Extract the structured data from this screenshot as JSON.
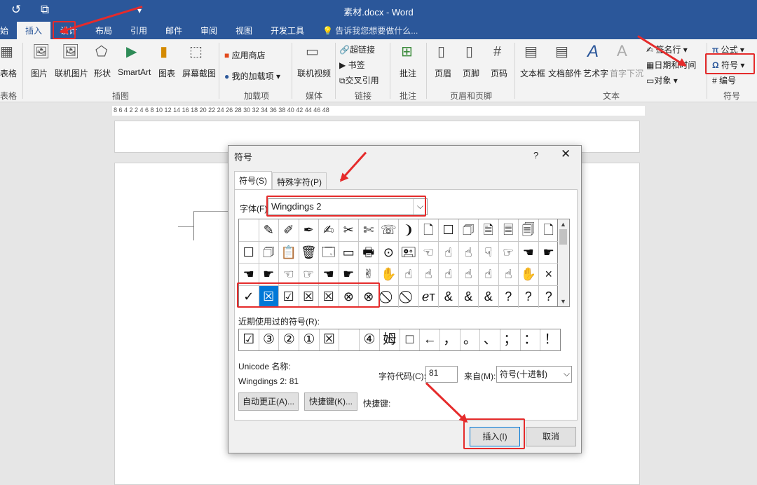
{
  "titlebar": {
    "title": "素材.docx - Word",
    "undo_icon": "↺",
    "cloud_icon": "⧉",
    "dropdown_icon": "▾"
  },
  "tabs": [
    "始",
    "插入",
    "设计",
    "布局",
    "引用",
    "邮件",
    "审阅",
    "视图",
    "开发工具"
  ],
  "tell_me": "告诉我您想要做什么...",
  "ribbon": {
    "table": "表格",
    "group_table": "表格",
    "pictures": "图片",
    "online_pictures": "联机图片",
    "shapes": "形状",
    "smartart": "SmartArt",
    "chart": "图表",
    "screenshot": "屏幕截图",
    "group_illustrations": "插图",
    "store": "应用商店",
    "my_addins": "我的加载项",
    "group_addins": "加载项",
    "online_video": "联机视频",
    "group_media": "媒体",
    "hyperlink": "超链接",
    "bookmark": "书签",
    "cross_ref": "交叉引用",
    "group_links": "链接",
    "comment": "批注",
    "group_comments": "批注",
    "header": "页眉",
    "footer": "页脚",
    "page_number": "页码",
    "group_hf": "页眉和页脚",
    "textbox": "文本框",
    "quick_parts": "文档部件",
    "wordart": "艺术字",
    "drop_cap": "首字下沉",
    "signature": "签名行",
    "datetime": "日期和时间",
    "object": "对象",
    "group_text": "文本",
    "equation": "公式",
    "symbol": "符号",
    "numbering": "编号",
    "group_symbols": "符号"
  },
  "ruler_ticks": "8   6   4   2     2   4   6   8   10  12  14  16  18  20  22  24  26  28  30  32  34  36  38  40  42  44  46  48",
  "dialog": {
    "title": "符号",
    "help": "?",
    "close": "✕",
    "tab_symbols": "符号(S)",
    "tab_special": "特殊字符(P)",
    "font_label": "字体(F):",
    "font_value": "Wingdings 2",
    "dropdown_arrow": "⌵",
    "grid": [
      [
        "",
        "✎",
        "✐",
        "✒",
        "✍",
        "✂",
        "✄",
        "☏",
        "❩",
        "🗋",
        "☐",
        "🗇",
        "🗎",
        "🗏",
        "🗐",
        "🗋"
      ],
      [
        "☐",
        "🗇",
        "📋",
        "🗑",
        "🗔",
        "▭",
        "🖶",
        "⊙",
        "🖭",
        "☜",
        "☝",
        "☝",
        "☟",
        "☞",
        "☚",
        "☛"
      ],
      [
        "☚",
        "☛",
        "☜",
        "☞",
        "☚",
        "☛",
        "✌",
        "✋",
        "☝",
        "☝",
        "☝",
        "☝",
        "☝",
        "☝",
        "✋",
        "×"
      ],
      [
        "✓",
        "☒",
        "☑",
        "☒",
        "☒",
        "⊗",
        "⊗",
        "⃠",
        "⃠",
        "ℯᴛ",
        "&",
        "&",
        "&",
        "?",
        "?",
        "?"
      ]
    ],
    "selected_cell": "☒",
    "recent_label": "近期使用过的符号(R):",
    "recent": [
      "☑",
      "③",
      "②",
      "①",
      "☒",
      "",
      "④",
      "姆",
      "□",
      "←",
      "，",
      "。",
      "、",
      "；",
      "：",
      "！"
    ],
    "unicode_name_label": "Unicode 名称:",
    "unicode_name_value": "Wingdings 2: 81",
    "char_code_label": "字符代码(C):",
    "char_code_value": "81",
    "from_label": "来自(M):",
    "from_value": "符号(十进制)",
    "autocorrect_btn": "自动更正(A)...",
    "shortcut_btn": "快捷键(K)...",
    "shortcut_label": "快捷键:",
    "insert_btn": "插入(I)",
    "cancel_btn": "取消"
  },
  "colors": {
    "word_blue": "#2b579a",
    "highlight_red": "#e52b2b",
    "selection_blue": "#0078d7"
  }
}
